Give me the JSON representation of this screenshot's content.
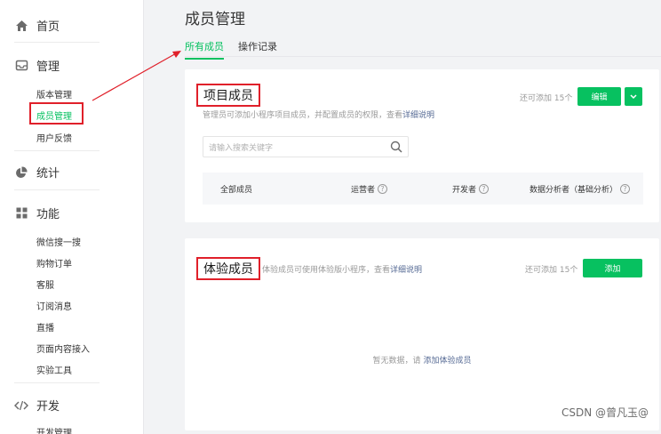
{
  "sidebar": {
    "home": {
      "label": "首页",
      "icon": "home-icon"
    },
    "manage": {
      "label": "管理",
      "icon": "inbox-icon",
      "items": [
        "版本管理",
        "成员管理",
        "用户反馈"
      ]
    },
    "stats": {
      "label": "统计",
      "icon": "pie-chart-icon"
    },
    "features": {
      "label": "功能",
      "icon": "grid-icon",
      "items": [
        "微信搜一搜",
        "购物订单",
        "客服",
        "订阅消息",
        "直播",
        "页面内容接入",
        "实验工具"
      ]
    },
    "dev": {
      "label": "开发",
      "icon": "code-icon",
      "items": [
        "开发管理"
      ]
    }
  },
  "main": {
    "title": "成员管理",
    "tabs": [
      "所有成员",
      "操作记录"
    ],
    "project": {
      "title": "项目成员",
      "desc": "管理员可添加小程序项目成员，并配置成员的权限，查看",
      "desc_link": "详细说明",
      "quota": "还可添加 15个",
      "edit_button": "编辑",
      "search_placeholder": "请输入搜索关键字",
      "columns": [
        "全部成员",
        "运营者",
        "开发者",
        "数据分析者（基础分析）"
      ]
    },
    "trial": {
      "title": "体验成员",
      "desc": "体验成员可使用体验版小程序，查看",
      "desc_link": "详细说明",
      "quota": "还可添加 15个",
      "add_button": "添加",
      "empty_text": "暂无数据，请",
      "empty_link": "添加体验成员"
    }
  },
  "watermark": "CSDN @曾凡玉@",
  "colors": {
    "accent": "#07c160",
    "highlight": "#e0202a",
    "link": "#576b95"
  }
}
